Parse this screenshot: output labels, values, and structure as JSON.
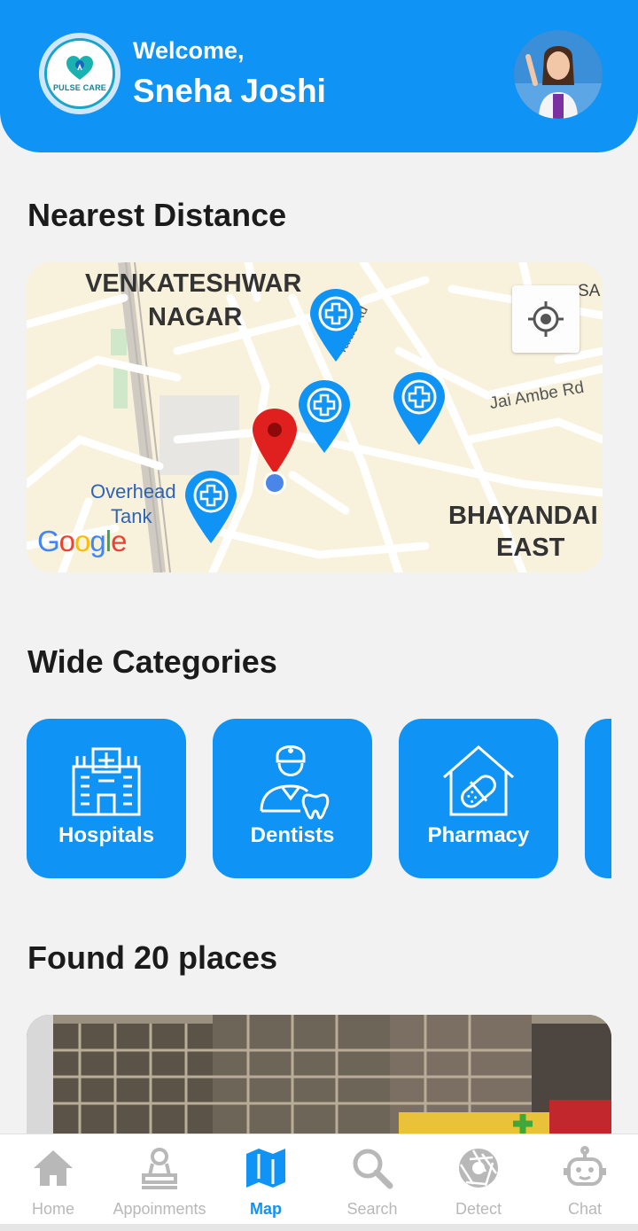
{
  "header": {
    "welcome": "Welcome,",
    "username": "Sneha Joshi",
    "logo_text": "PULSE CARE"
  },
  "sections": {
    "nearest": "Nearest Distance",
    "categories": "Wide Categories",
    "found": "Found 20 places"
  },
  "map": {
    "labels": {
      "area1_line1": "VENKATESHWAR",
      "area1_line2": "NAGAR",
      "area2_line1": "BHAYANDAI",
      "area2_line2": "EAST",
      "tank_line1": "Overhead",
      "tank_line2": "Tank",
      "road1": "Jai Ambe Rd",
      "road2": "Talao Rd",
      "corner": "SA",
      "google": "Google"
    }
  },
  "categories": [
    {
      "label": "Hospitals",
      "icon": "hospital-icon"
    },
    {
      "label": "Dentists",
      "icon": "dentist-icon"
    },
    {
      "label": "Pharmacy",
      "icon": "pharmacy-icon"
    }
  ],
  "nav": [
    {
      "label": "Home",
      "icon": "home-icon",
      "active": false
    },
    {
      "label": "Appoinments",
      "icon": "appointments-icon",
      "active": false
    },
    {
      "label": "Map",
      "icon": "map-icon",
      "active": true
    },
    {
      "label": "Search",
      "icon": "search-icon",
      "active": false
    },
    {
      "label": "Detect",
      "icon": "aperture-icon",
      "active": false
    },
    {
      "label": "Chat",
      "icon": "robot-icon",
      "active": false
    }
  ],
  "colors": {
    "primary": "#0f93f5",
    "background": "#f2f2f2",
    "nav_inactive": "#b8b8b8",
    "pin_red": "#e0201f"
  }
}
